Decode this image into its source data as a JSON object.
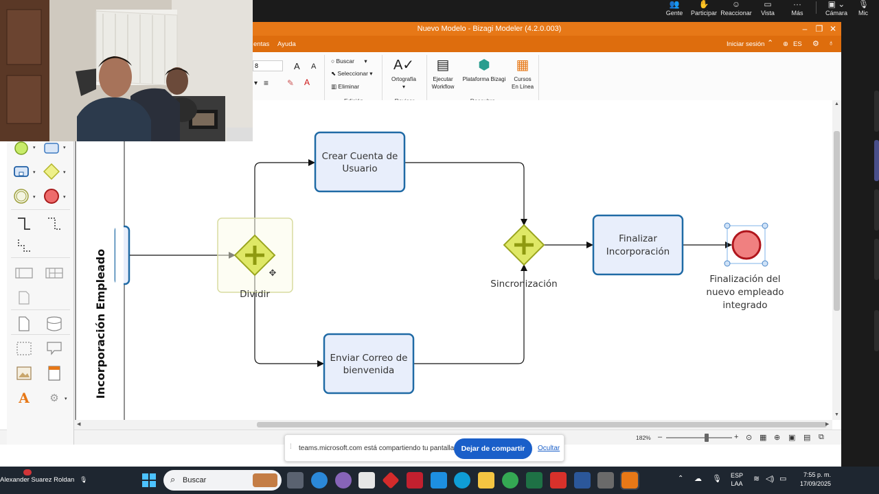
{
  "teams": {
    "buttons": [
      {
        "label": "Gente",
        "icon": "people-icon"
      },
      {
        "label": "Participar",
        "icon": "hand-icon"
      },
      {
        "label": "Reaccionar",
        "icon": "smile-icon"
      },
      {
        "label": "Vista",
        "icon": "view-icon"
      },
      {
        "label": "Más",
        "icon": "more-icon"
      },
      {
        "label": "Cámara",
        "icon": "camera-icon"
      },
      {
        "label": "Mic",
        "icon": "mic-icon"
      }
    ]
  },
  "window": {
    "title": "Nuevo Modelo - Bizagi Modeler (4.2.0.003)",
    "menu": [
      "entas",
      "Ayuda"
    ],
    "menu_right": {
      "login": "Iniciar sesión",
      "lang": "ES"
    },
    "font_size": "8"
  },
  "ribbon": {
    "edicion": {
      "label": "Edición",
      "buscar": "Buscar",
      "seleccionar": "Seleccionar",
      "eliminar": "Eliminar"
    },
    "revisar": {
      "label": "Revisar",
      "ortografia": "Ortografía"
    },
    "descubra": {
      "label": "Descubra",
      "ejecutar": [
        "Ejecutar",
        "Workflow"
      ],
      "plataforma": "Plataforma Bizagi",
      "cursos": [
        "Cursos",
        "En Línea"
      ]
    }
  },
  "diagram": {
    "lane_label": "Incorporación Empleado",
    "tasks": {
      "crear": [
        "Crear Cuenta de",
        "Usuario"
      ],
      "enviar": [
        "Enviar Correo de",
        "bienvenida"
      ],
      "finalizar": [
        "Finalizar",
        "Incorporación"
      ]
    },
    "gateways": {
      "split": "Dividir",
      "join": "Sincronización"
    },
    "end_event": [
      "Finalización del",
      "nuevo empleado",
      "integrado"
    ],
    "colors": {
      "task_fill": "#e8eefb",
      "task_stroke": "#1f6aa5",
      "gateway_fill": "#dfe866",
      "gateway_stroke": "#9aa520",
      "end_fill": "#f08080",
      "end_stroke": "#b0151c"
    }
  },
  "status": {
    "zoom": "182%"
  },
  "share": {
    "text": "teams.microsoft.com está compartiendo tu pantalla.",
    "stop": "Dejar de compartir",
    "hide": "Ocultar"
  },
  "taskbar": {
    "user": "Alexander Suarez Roldan",
    "search_placeholder": "Buscar",
    "lang": [
      "ESP",
      "LAA"
    ],
    "time": "7:55 p. m.",
    "date": "17/09/2025"
  }
}
